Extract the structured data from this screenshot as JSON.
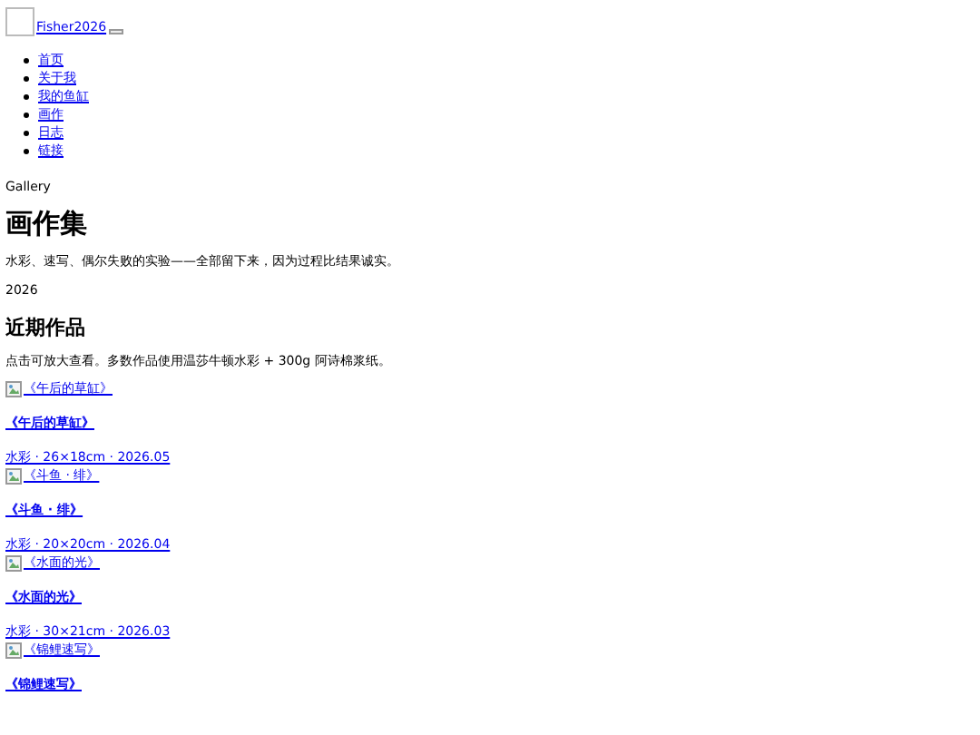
{
  "header": {
    "brand": "Fisher2026"
  },
  "nav": [
    "首页",
    "关于我",
    "我的鱼缸",
    "画作",
    "日志",
    "链接"
  ],
  "eyebrow": "Gallery",
  "title": "画作集",
  "intro": "水彩、速写、偶尔失败的实验——全部留下来，因为过程比结果诚实。",
  "year": "2026",
  "section": {
    "title": "近期作品",
    "note": "点击可放大查看。多数作品使用温莎牛顿水彩 + 300g 阿诗棉浆纸。"
  },
  "works": [
    {
      "image_alt": "《午后的草缸》",
      "title": "《午后的草缸》",
      "meta": "水彩 · 26×18cm · 2026.05"
    },
    {
      "image_alt": "《斗鱼 · 绯》",
      "title": "《斗鱼 · 绯》",
      "meta": "水彩 · 20×20cm · 2026.04"
    },
    {
      "image_alt": "《水面的光》",
      "title": "《水面的光》",
      "meta": "水彩 · 30×21cm · 2026.03"
    },
    {
      "image_alt": "《锦鲤速写》",
      "title": "《锦鲤速写》"
    }
  ]
}
